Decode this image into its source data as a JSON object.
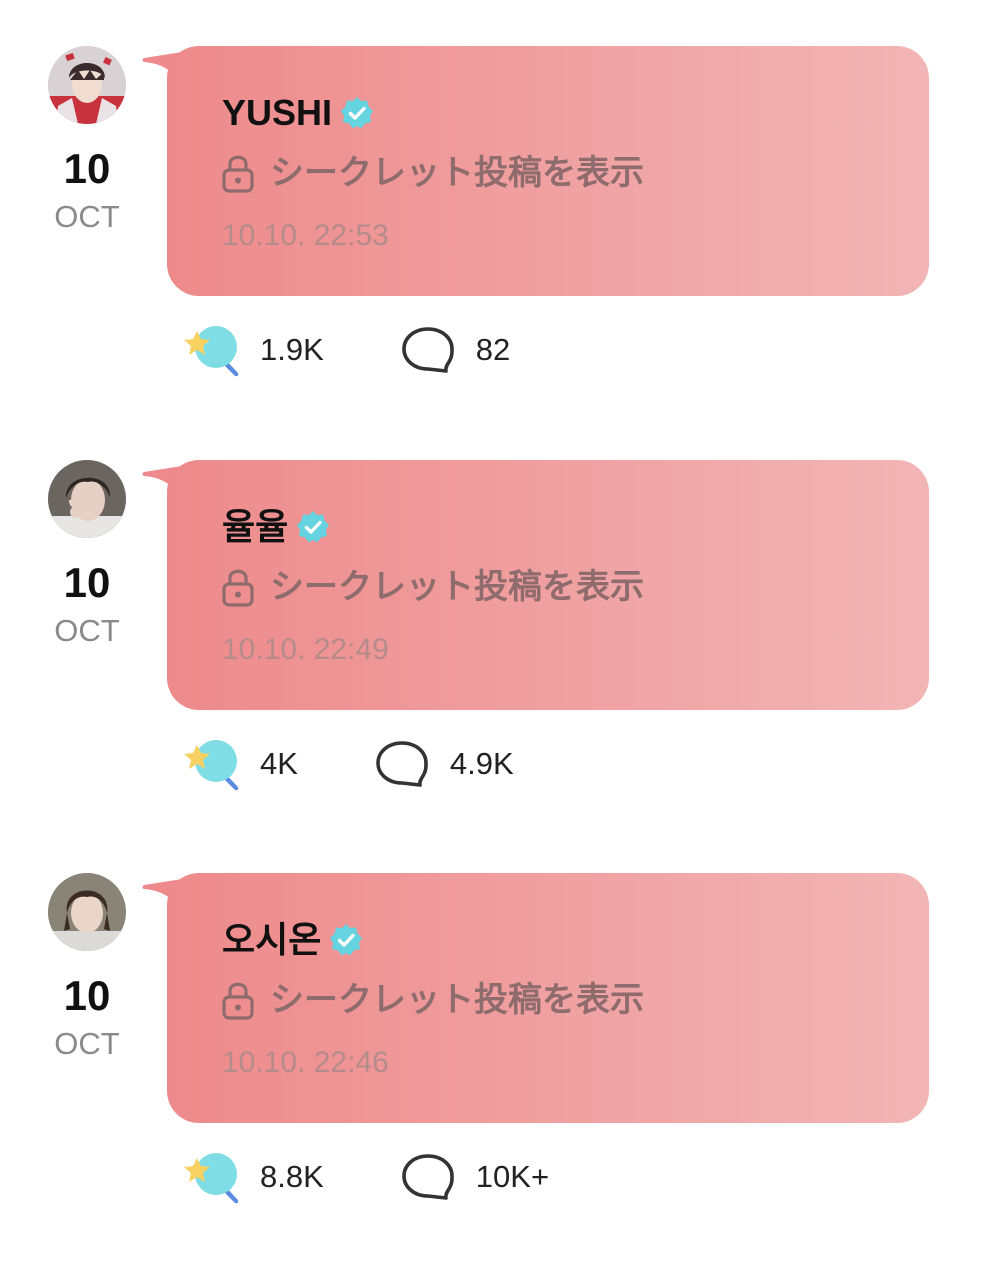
{
  "colors": {
    "bubble_start": "#ee8a8b",
    "bubble_end": "#f2b5b5",
    "verified_badge": "#66d3e0",
    "secret_text": "#8e6b6c",
    "timestamp_text": "#b58a8b",
    "month_text": "#8a8a8a"
  },
  "posts": [
    {
      "author": "YUSHI",
      "day": "10",
      "month": "OCT",
      "secret_label": "シークレット投稿を表示",
      "timestamp": "10.10. 22:53",
      "likes": "1.9K",
      "comments": "82",
      "avatar_icon": "avatar-photo",
      "verified_icon": "verified-badge-icon"
    },
    {
      "author": "율율",
      "day": "10",
      "month": "OCT",
      "secret_label": "シークレット投稿を表示",
      "timestamp": "10.10. 22:49",
      "likes": "4K",
      "comments": "4.9K",
      "avatar_icon": "avatar-photo",
      "verified_icon": "verified-badge-icon"
    },
    {
      "author": "오시온",
      "day": "10",
      "month": "OCT",
      "secret_label": "シークレット投稿を表示",
      "timestamp": "10.10. 22:46",
      "likes": "8.8K",
      "comments": "10K+",
      "avatar_icon": "avatar-photo",
      "verified_icon": "verified-badge-icon"
    }
  ]
}
